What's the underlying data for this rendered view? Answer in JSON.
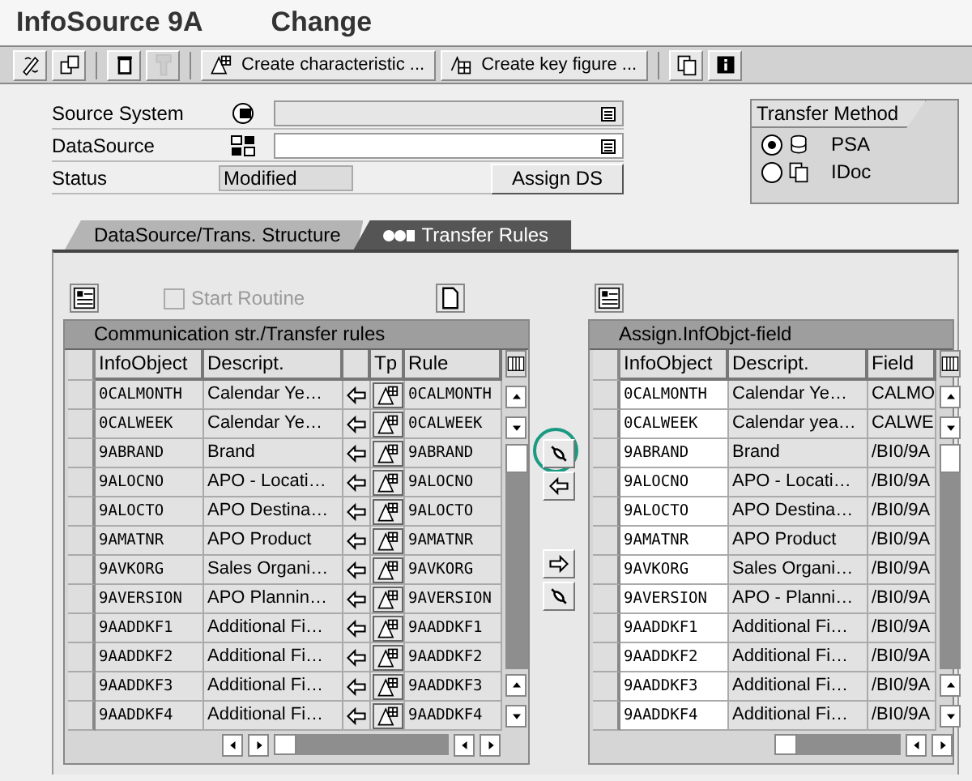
{
  "window": {
    "title": "InfoSource 9A",
    "mode": "Change"
  },
  "toolbar": [
    {
      "kind": "icon"
    },
    {
      "kind": "icon"
    },
    {
      "kind": "separator"
    },
    {
      "kind": "icon"
    },
    {
      "kind": "icon",
      "disabled": true
    },
    {
      "kind": "separator"
    },
    {
      "kind": "text",
      "label": "Create characteristic ..."
    },
    {
      "kind": "text",
      "label": "Create key figure ..."
    },
    {
      "kind": "separator"
    },
    {
      "kind": "icon"
    },
    {
      "kind": "icon"
    }
  ],
  "form": {
    "fields": [
      {
        "label": "Source System",
        "kind": "input",
        "editable": false
      },
      {
        "label": "DataSource",
        "kind": "input",
        "editable": true
      },
      {
        "label": "Status",
        "kind": "display",
        "value": "Modified"
      }
    ],
    "assign_button": "Assign DS"
  },
  "transfer_method": {
    "title": "Transfer Method",
    "options": [
      {
        "label": "PSA",
        "selected": true
      },
      {
        "label": "IDoc",
        "selected": false
      }
    ]
  },
  "tabs": [
    {
      "label": "DataSource/Trans. Structure",
      "selected": false
    },
    {
      "label": "Transfer Rules",
      "selected": true
    }
  ],
  "start_routine": {
    "label": "Start Routine",
    "checked": false,
    "disabled": true
  },
  "rules_table": {
    "title": "Communication str./Transfer rules",
    "columns": [
      "InfoObject",
      "Descript.",
      "Tp",
      "Rule"
    ],
    "rows": [
      {
        "infoobject": "0CALMONTH",
        "description": "Calendar Ye…",
        "rule": "0CALMONTH"
      },
      {
        "infoobject": "0CALWEEK",
        "description": "Calendar Ye…",
        "rule": "0CALWEEK"
      },
      {
        "infoobject": "9ABRAND",
        "description": "Brand",
        "rule": "9ABRAND"
      },
      {
        "infoobject": "9ALOCNO",
        "description": "APO - Locati…",
        "rule": "9ALOCNO"
      },
      {
        "infoobject": "9ALOCTO",
        "description": "APO Destina…",
        "rule": "9ALOCTO"
      },
      {
        "infoobject": "9AMATNR",
        "description": "APO Product",
        "rule": "9AMATNR"
      },
      {
        "infoobject": "9AVKORG",
        "description": "Sales Organi…",
        "rule": "9AVKORG"
      },
      {
        "infoobject": "9AVERSION",
        "description": "APO Plannin…",
        "rule": "9AVERSION"
      },
      {
        "infoobject": "9AADDKF1",
        "description": "Additional Fi…",
        "rule": "9AADDKF1"
      },
      {
        "infoobject": "9AADDKF2",
        "description": "Additional Fi…",
        "rule": "9AADDKF2"
      },
      {
        "infoobject": "9AADDKF3",
        "description": "Additional Fi…",
        "rule": "9AADDKF3"
      },
      {
        "infoobject": "9AADDKF4",
        "description": "Additional Fi…",
        "rule": "9AADDKF4"
      }
    ]
  },
  "assign_table": {
    "title": "Assign.InfObjct-field",
    "columns": [
      "InfoObject",
      "Descript.",
      "Field"
    ],
    "rows": [
      {
        "infoobject": "0CALMONTH",
        "description": "Calendar Ye…",
        "field": "CALMO"
      },
      {
        "infoobject": "0CALWEEK",
        "description": "Calendar yea…",
        "field": "CALWE"
      },
      {
        "infoobject": "9ABRAND",
        "description": "Brand",
        "field": "/BI0/9A"
      },
      {
        "infoobject": "9ALOCNO",
        "description": "APO - Locati…",
        "field": "/BI0/9A"
      },
      {
        "infoobject": "9ALOCTO",
        "description": "APO Destina…",
        "field": "/BI0/9A"
      },
      {
        "infoobject": "9AMATNR",
        "description": "APO Product",
        "field": "/BI0/9A"
      },
      {
        "infoobject": "9AVKORG",
        "description": "Sales Organi…",
        "field": "/BI0/9A"
      },
      {
        "infoobject": "9AVERSION",
        "description": "APO - Planni…",
        "field": "/BI0/9A"
      },
      {
        "infoobject": "9AADDKF1",
        "description": "Additional Fi…",
        "field": "/BI0/9A"
      },
      {
        "infoobject": "9AADDKF2",
        "description": "Additional Fi…",
        "field": "/BI0/9A"
      },
      {
        "infoobject": "9AADDKF3",
        "description": "Additional Fi…",
        "field": "/BI0/9A"
      },
      {
        "infoobject": "9AADDKF4",
        "description": "Additional Fi…",
        "field": "/BI0/9A"
      }
    ]
  },
  "transfer_buttons": [
    {
      "kind": "link",
      "highlighted": true
    },
    {
      "kind": "left"
    },
    {
      "kind": "right"
    },
    {
      "kind": "unlink"
    }
  ]
}
